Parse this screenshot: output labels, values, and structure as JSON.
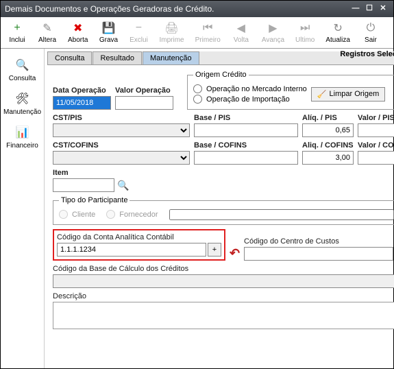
{
  "window": {
    "title": "Demais Documentos e Operações Geradoras de Crédito."
  },
  "toolbar": [
    {
      "label": "Inclui",
      "icon": "+",
      "color": "#2a8a2a"
    },
    {
      "label": "Altera",
      "icon": "✎",
      "color": "#888"
    },
    {
      "label": "Aborta",
      "icon": "✖",
      "color": "#d00"
    },
    {
      "label": "Grava",
      "icon": "💾",
      "color": "#333"
    },
    {
      "label": "Exclui",
      "icon": "−",
      "color": "#aaa"
    },
    {
      "label": "Imprime",
      "icon": "🖨",
      "color": "#aaa"
    },
    {
      "label": "Primeiro",
      "icon": "⏮",
      "color": "#aaa"
    },
    {
      "label": "Volta",
      "icon": "◀",
      "color": "#aaa"
    },
    {
      "label": "Avança",
      "icon": "▶",
      "color": "#aaa"
    },
    {
      "label": "Ultimo",
      "icon": "⏭",
      "color": "#aaa"
    },
    {
      "label": "Atualiza",
      "icon": "↻",
      "color": "#888"
    },
    {
      "label": "Sair",
      "icon": "⏻",
      "color": "#888"
    }
  ],
  "sidebar": [
    {
      "label": "Consulta",
      "icon": "🔍"
    },
    {
      "label": "Manutenção",
      "icon": "🛠"
    },
    {
      "label": "Financeiro",
      "icon": "📊"
    }
  ],
  "tabs": [
    "Consulta",
    "Resultado",
    "Manutenção"
  ],
  "active_tab": 2,
  "reg_sel": "Registros Selecionados",
  "form": {
    "data_op_label": "Data Operação",
    "data_op_value": "11/05/2018",
    "valor_op_label": "Valor Operação",
    "valor_op_value": "",
    "origem_legend": "Origem Crédito",
    "origem_opt1": "Operação no Mercado Interno",
    "origem_opt2": "Operação de Importação",
    "limpar": "Limpar Origem",
    "cst_pis": "CST/PIS",
    "base_pis": "Base / PIS",
    "aliq_pis": "Alíq. / PIS",
    "aliq_pis_val": "0,65",
    "valor_pis": "Valor / PIS",
    "cst_cofins": "CST/COFINS",
    "base_cofins": "Base / COFINS",
    "aliq_cofins": "Aliq. / COFINS",
    "aliq_cofins_val": "3,00",
    "valor_cofins": "Valor / COFINS",
    "item": "Item",
    "tipo_part": "Tipo do Participante",
    "cliente": "Cliente",
    "fornecedor": "Fornecedor",
    "cod_conta": "Código da Conta Analítica Contábil",
    "cod_conta_val": "1.1.1.1234",
    "cod_centro": "Código do Centro de Custos",
    "cod_base": "Código da Base de Cálculo dos Créditos",
    "descricao": "Descrição"
  }
}
